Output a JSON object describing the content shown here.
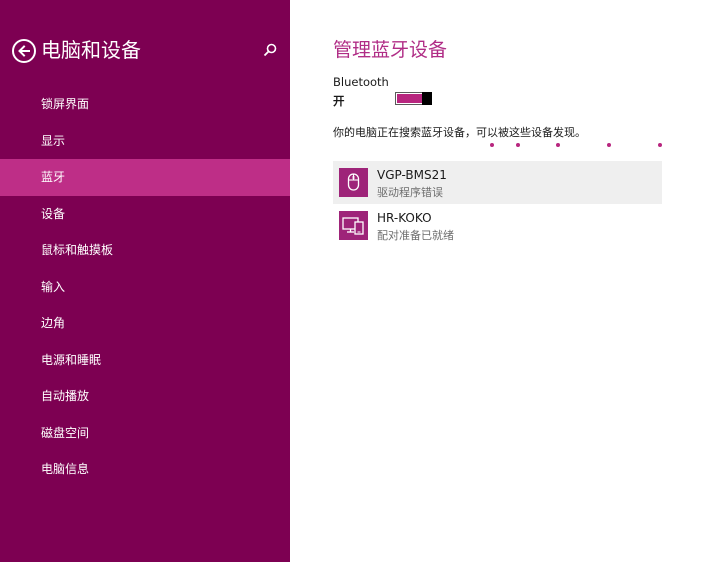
{
  "sidebar": {
    "title": "电脑和设备",
    "back_icon": "back-arrow-icon",
    "search_icon": "search-icon",
    "items": [
      {
        "label": "锁屏界面",
        "selected": false
      },
      {
        "label": "显示",
        "selected": false
      },
      {
        "label": "蓝牙",
        "selected": true
      },
      {
        "label": "设备",
        "selected": false
      },
      {
        "label": "鼠标和触摸板",
        "selected": false
      },
      {
        "label": "输入",
        "selected": false
      },
      {
        "label": "边角",
        "selected": false
      },
      {
        "label": "电源和睡眠",
        "selected": false
      },
      {
        "label": "自动播放",
        "selected": false
      },
      {
        "label": "磁盘空间",
        "selected": false
      },
      {
        "label": "电脑信息",
        "selected": false
      }
    ]
  },
  "main": {
    "title": "管理蓝牙设备",
    "bluetooth": {
      "label": "Bluetooth",
      "state_label": "开",
      "on": true
    },
    "search_status": "你的电脑正在搜索蓝牙设备，可以被这些设备发现。",
    "devices": [
      {
        "name": "VGP-BMS21",
        "status": "驱动程序错误",
        "icon": "mouse-icon"
      },
      {
        "name": "HR-KOKO",
        "status": "配对准备已就绪",
        "icon": "phone-pc-icon"
      }
    ]
  },
  "colors": {
    "sidebar_bg": "#7d0052",
    "sidebar_selected": "#be2e87",
    "accent": "#b02d86",
    "device_tile": "#9e2479"
  }
}
